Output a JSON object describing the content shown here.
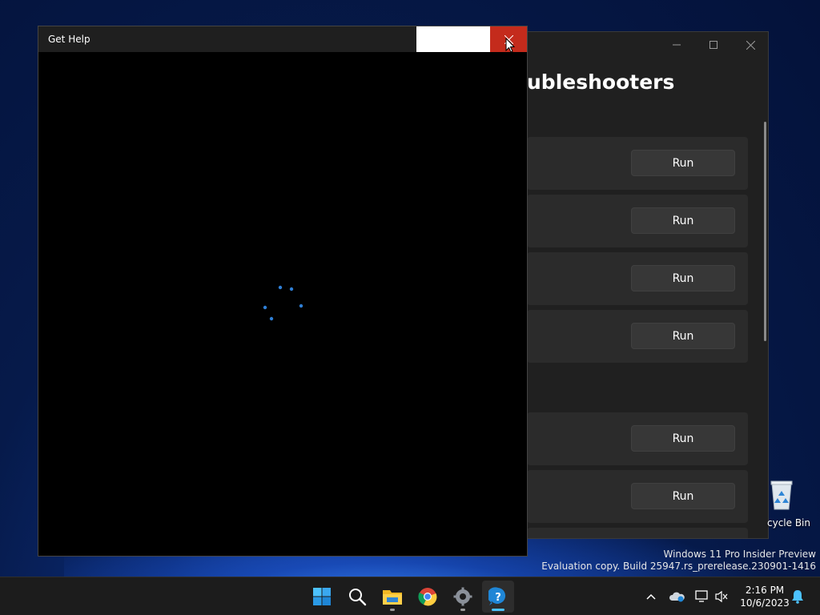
{
  "settings_window": {
    "title_fragment": "ubleshooters",
    "run_label": "Run",
    "rows": [
      "Run",
      "Run",
      "Run",
      "Run",
      "Run",
      "Run"
    ]
  },
  "gethelp_window": {
    "title": "Get Help"
  },
  "desktop": {
    "recycle_bin_label": "cycle Bin",
    "watermark_line1": "Windows 11 Pro Insider Preview",
    "watermark_line2": "Evaluation copy. Build 25947.rs_prerelease.230901-1416"
  },
  "taskbar": {
    "apps": [
      "start-icon",
      "search-icon",
      "file-explorer-icon",
      "chrome-icon",
      "settings-icon",
      "get-help-icon"
    ],
    "time": "2:16 PM",
    "date": "10/6/2023"
  },
  "colors": {
    "close_red": "#c42b1c",
    "accent_blue": "#4cc2ff",
    "spinner_blue": "#2f7fd6"
  }
}
